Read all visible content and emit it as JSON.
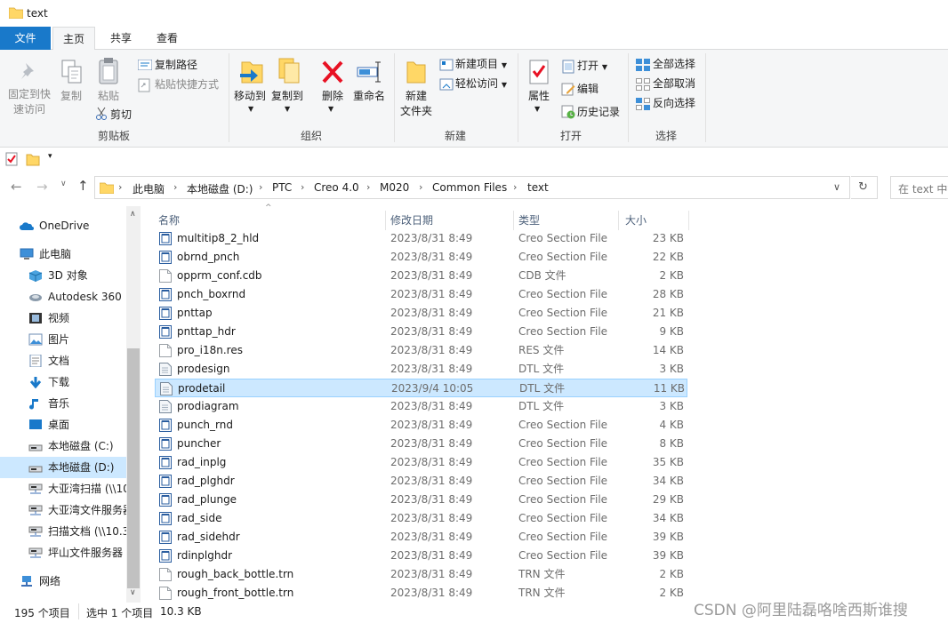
{
  "window": {
    "title": "text"
  },
  "tabs": [
    {
      "label": "文件"
    },
    {
      "label": "主页"
    },
    {
      "label": "共享"
    },
    {
      "label": "查看"
    }
  ],
  "ribbon": {
    "clipboard": {
      "group": "剪贴板",
      "pin": "固定到快\n速访问",
      "copy": "复制",
      "paste": "粘贴",
      "copy_path": "复制路径",
      "paste_shortcut": "粘贴快捷方式",
      "cut": "剪切"
    },
    "organize": {
      "group": "组织",
      "move_to": "移动到",
      "copy_to": "复制到",
      "delete": "删除",
      "rename": "重命名"
    },
    "new": {
      "group": "新建",
      "new_folder": "新建\n文件夹",
      "new_item": "新建项目",
      "easy_access": "轻松访问"
    },
    "open": {
      "group": "打开",
      "properties": "属性",
      "open": "打开",
      "edit": "编辑",
      "history": "历史记录"
    },
    "select": {
      "group": "选择",
      "select_all": "全部选择",
      "select_none": "全部取消",
      "invert": "反向选择"
    }
  },
  "address": {
    "crumbs": [
      "此电脑",
      "本地磁盘 (D:)",
      "PTC",
      "Creo 4.0",
      "M020",
      "Common Files",
      "text"
    ],
    "search_placeholder": "在 text 中搜索"
  },
  "nav": [
    {
      "label": "OneDrive",
      "icon": "cloud-icon"
    },
    {
      "label": "此电脑",
      "icon": "computer-icon"
    },
    {
      "label": "3D 对象",
      "icon": "cube-icon"
    },
    {
      "label": "Autodesk 360",
      "icon": "autodesk-icon"
    },
    {
      "label": "视频",
      "icon": "video-icon"
    },
    {
      "label": "图片",
      "icon": "picture-icon"
    },
    {
      "label": "文档",
      "icon": "document-icon"
    },
    {
      "label": "下载",
      "icon": "download-icon"
    },
    {
      "label": "音乐",
      "icon": "music-icon"
    },
    {
      "label": "桌面",
      "icon": "desktop-icon"
    },
    {
      "label": "本地磁盘 (C:)",
      "icon": "drive-icon"
    },
    {
      "label": "本地磁盘 (D:)",
      "icon": "drive-icon"
    },
    {
      "label": "大亚湾扫描 (\\\\10",
      "icon": "network-drive-icon"
    },
    {
      "label": "大亚湾文件服务器",
      "icon": "network-drive-icon"
    },
    {
      "label": "扫描文档 (\\\\10.3",
      "icon": "network-drive-icon"
    },
    {
      "label": "坪山文件服务器",
      "icon": "network-drive-icon"
    },
    {
      "label": "网络",
      "icon": "network-icon"
    }
  ],
  "columns": {
    "name": "名称",
    "date": "修改日期",
    "type": "类型",
    "size": "大小"
  },
  "files": [
    {
      "name": "multitip8_2_hld",
      "date": "2023/8/31 8:49",
      "type": "Creo Section File",
      "size": "23 KB",
      "icon": "creo-section-icon"
    },
    {
      "name": "obrnd_pnch",
      "date": "2023/8/31 8:49",
      "type": "Creo Section File",
      "size": "22 KB",
      "icon": "creo-section-icon"
    },
    {
      "name": "opprm_conf.cdb",
      "date": "2023/8/31 8:49",
      "type": "CDB 文件",
      "size": "2 KB",
      "icon": "blank-file-icon"
    },
    {
      "name": "pnch_boxrnd",
      "date": "2023/8/31 8:49",
      "type": "Creo Section File",
      "size": "28 KB",
      "icon": "creo-section-icon"
    },
    {
      "name": "pnttap",
      "date": "2023/8/31 8:49",
      "type": "Creo Section File",
      "size": "21 KB",
      "icon": "creo-section-icon"
    },
    {
      "name": "pnttap_hdr",
      "date": "2023/8/31 8:49",
      "type": "Creo Section File",
      "size": "9 KB",
      "icon": "creo-section-icon"
    },
    {
      "name": "pro_i18n.res",
      "date": "2023/8/31 8:49",
      "type": "RES 文件",
      "size": "14 KB",
      "icon": "blank-file-icon"
    },
    {
      "name": "prodesign",
      "date": "2023/8/31 8:49",
      "type": "DTL 文件",
      "size": "3 KB",
      "icon": "dtl-file-icon"
    },
    {
      "name": "prodetail",
      "date": "2023/9/4 10:05",
      "type": "DTL 文件",
      "size": "11 KB",
      "icon": "dtl-file-icon",
      "selected": true
    },
    {
      "name": "prodiagram",
      "date": "2023/8/31 8:49",
      "type": "DTL 文件",
      "size": "3 KB",
      "icon": "dtl-file-icon"
    },
    {
      "name": "punch_rnd",
      "date": "2023/8/31 8:49",
      "type": "Creo Section File",
      "size": "4 KB",
      "icon": "creo-section-icon"
    },
    {
      "name": "puncher",
      "date": "2023/8/31 8:49",
      "type": "Creo Section File",
      "size": "8 KB",
      "icon": "creo-section-icon"
    },
    {
      "name": "rad_inplg",
      "date": "2023/8/31 8:49",
      "type": "Creo Section File",
      "size": "35 KB",
      "icon": "creo-section-icon"
    },
    {
      "name": "rad_plghdr",
      "date": "2023/8/31 8:49",
      "type": "Creo Section File",
      "size": "34 KB",
      "icon": "creo-section-icon"
    },
    {
      "name": "rad_plunge",
      "date": "2023/8/31 8:49",
      "type": "Creo Section File",
      "size": "29 KB",
      "icon": "creo-section-icon"
    },
    {
      "name": "rad_side",
      "date": "2023/8/31 8:49",
      "type": "Creo Section File",
      "size": "34 KB",
      "icon": "creo-section-icon"
    },
    {
      "name": "rad_sidehdr",
      "date": "2023/8/31 8:49",
      "type": "Creo Section File",
      "size": "39 KB",
      "icon": "creo-section-icon"
    },
    {
      "name": "rdinplghdr",
      "date": "2023/8/31 8:49",
      "type": "Creo Section File",
      "size": "39 KB",
      "icon": "creo-section-icon"
    },
    {
      "name": "rough_back_bottle.trn",
      "date": "2023/8/31 8:49",
      "type": "TRN 文件",
      "size": "2 KB",
      "icon": "blank-file-icon"
    },
    {
      "name": "rough_front_bottle.trn",
      "date": "2023/8/31 8:49",
      "type": "TRN 文件",
      "size": "2 KB",
      "icon": "blank-file-icon"
    }
  ],
  "status": {
    "count": "195 个项目",
    "selected": "选中 1 个项目",
    "size": "10.3 KB"
  },
  "watermark": "CSDN @阿里陆磊咯啥西斯谁搜",
  "colors": {
    "accent": "#1979ca",
    "selection": "#cce8ff",
    "selection_border": "#99d1ff",
    "delete_red": "#e81123",
    "folder": "#ffd766"
  }
}
